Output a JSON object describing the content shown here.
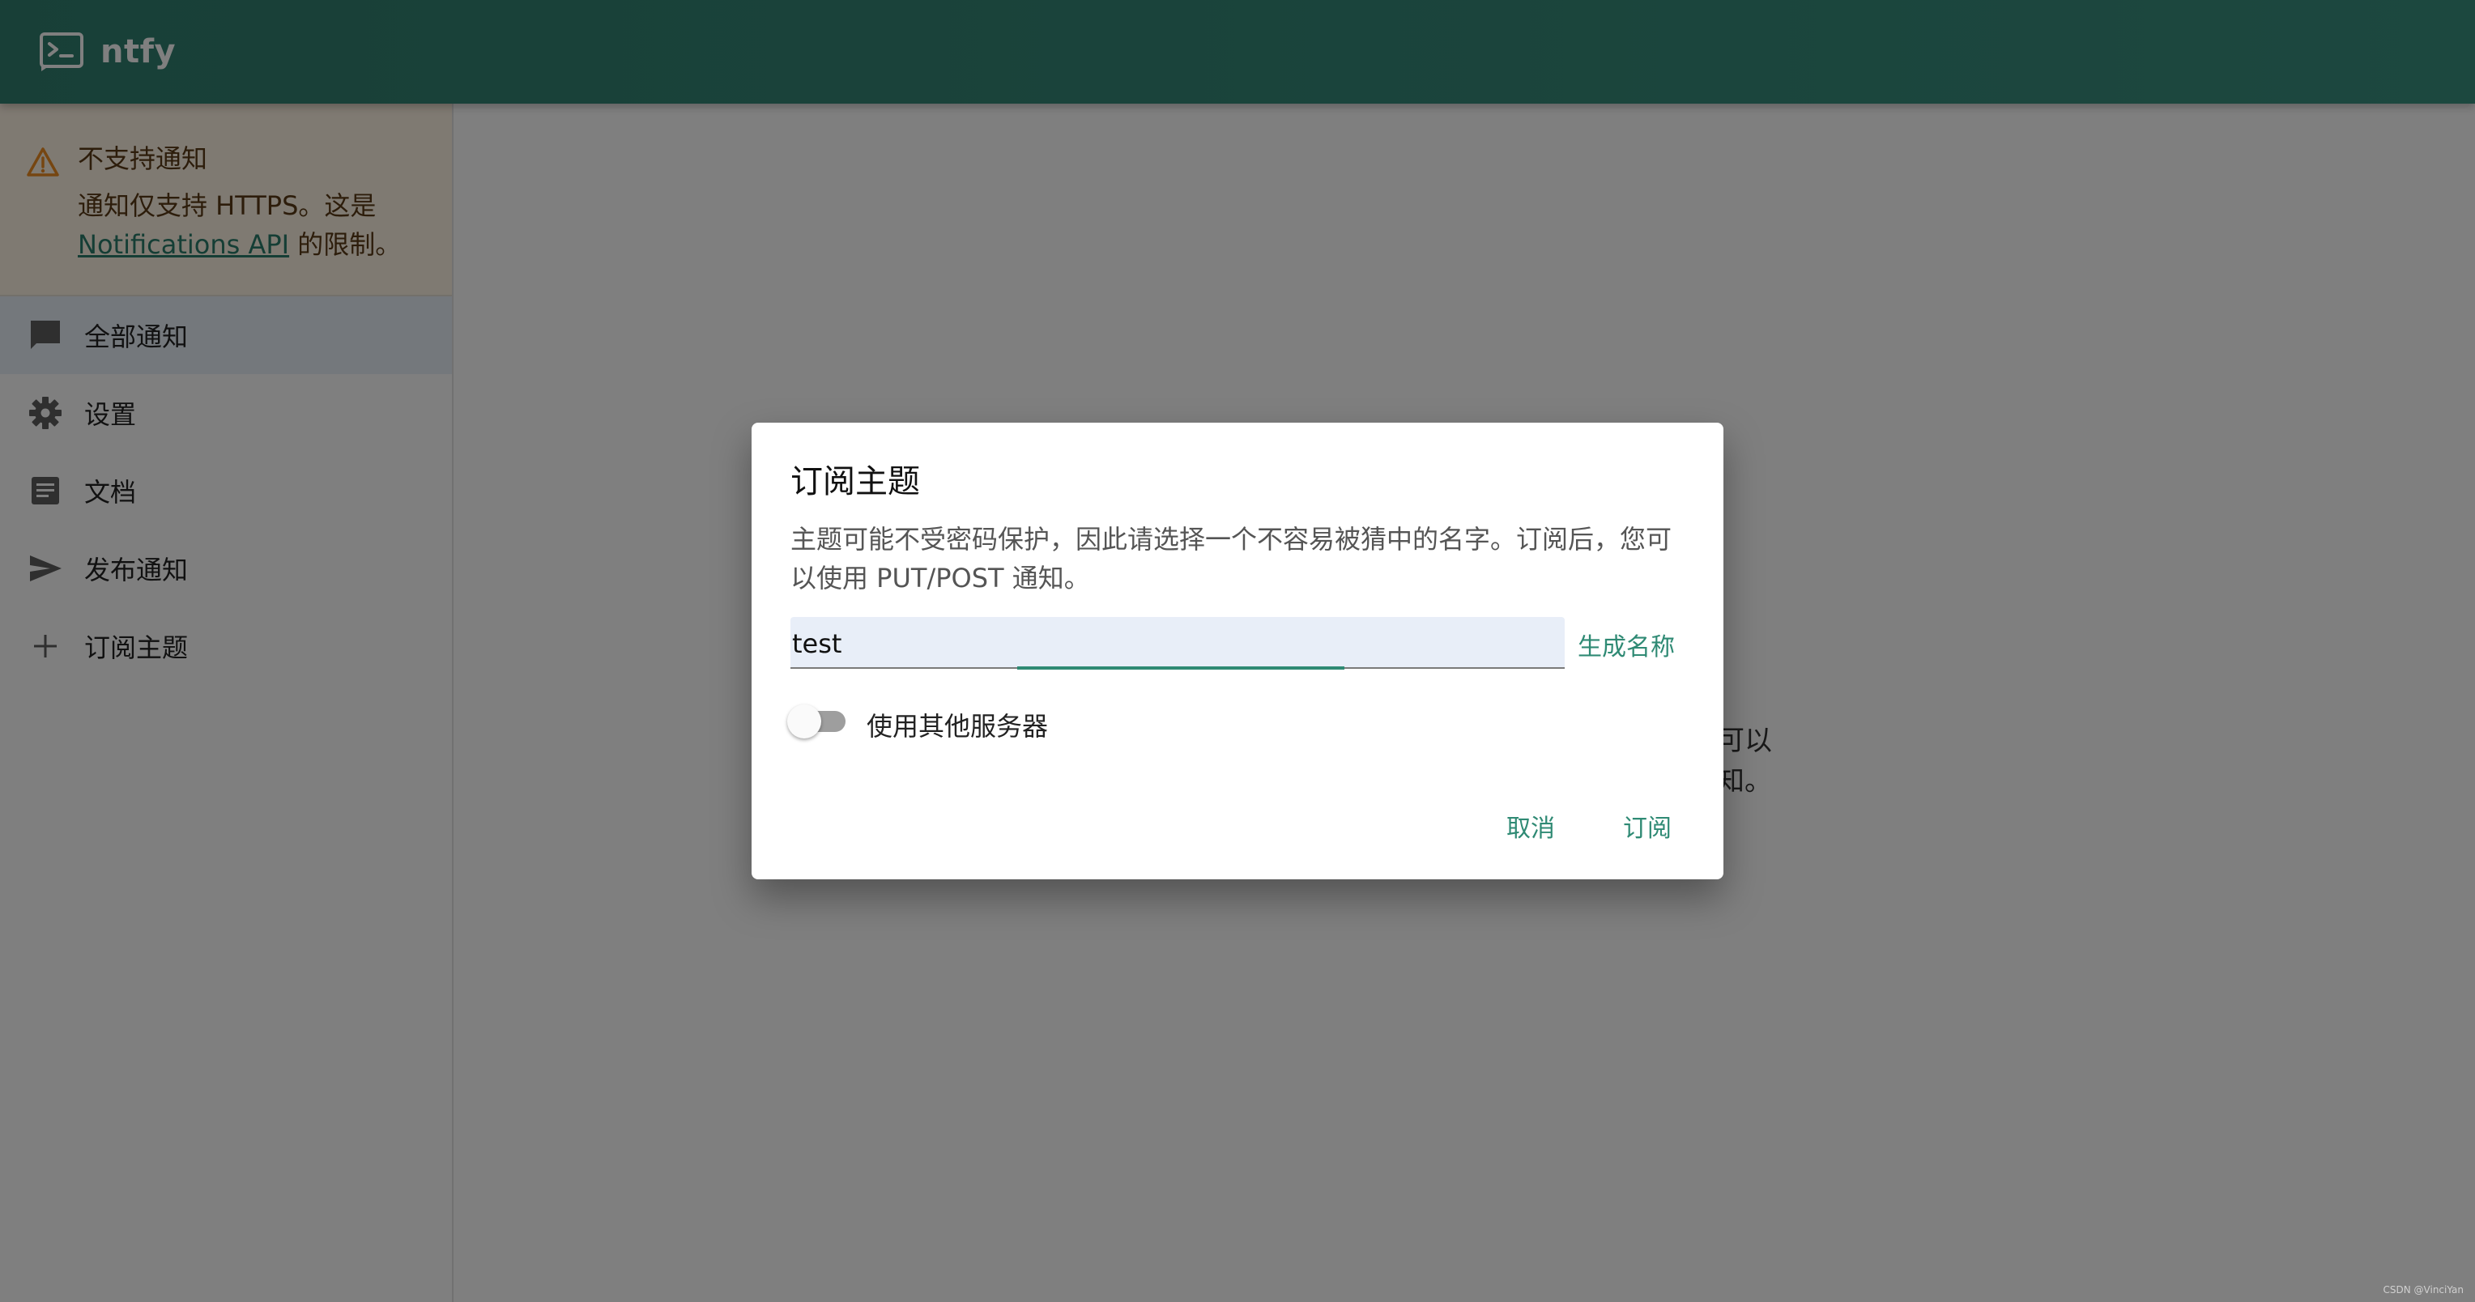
{
  "appbar": {
    "title": "ntfy"
  },
  "sidebar": {
    "alert": {
      "title": "不支持通知",
      "text_before": "通知仅支持 HTTPS。这是",
      "link": "Notifications API",
      "text_after": "的限制。"
    },
    "items": [
      {
        "label": "全部通知",
        "icon": "chat-bubble-icon",
        "active": true
      },
      {
        "label": "设置",
        "icon": "gear-icon",
        "active": false
      },
      {
        "label": "文档",
        "icon": "document-icon",
        "active": false
      },
      {
        "label": "发布通知",
        "icon": "send-icon",
        "active": false
      },
      {
        "label": "订阅主题",
        "icon": "plus-icon",
        "active": false
      }
    ]
  },
  "main": {
    "hint_line1": "可以",
    "hint_line2": "知。"
  },
  "dialog": {
    "title": "订阅主题",
    "description": "主题可能不受密码保护，因此请选择一个不容易被猜中的名字。订阅后，您可以使用 PUT/POST 通知。",
    "topic_value": "test",
    "generate_label": "生成名称",
    "switch_label": "使用其他服务器",
    "switch_on": false,
    "cancel_label": "取消",
    "subscribe_label": "订阅"
  },
  "watermark": "CSDN @VinciYan",
  "colors": {
    "primary": "#338574",
    "alert_bg": "#fff4e5",
    "alert_icon": "#ed8c22"
  }
}
